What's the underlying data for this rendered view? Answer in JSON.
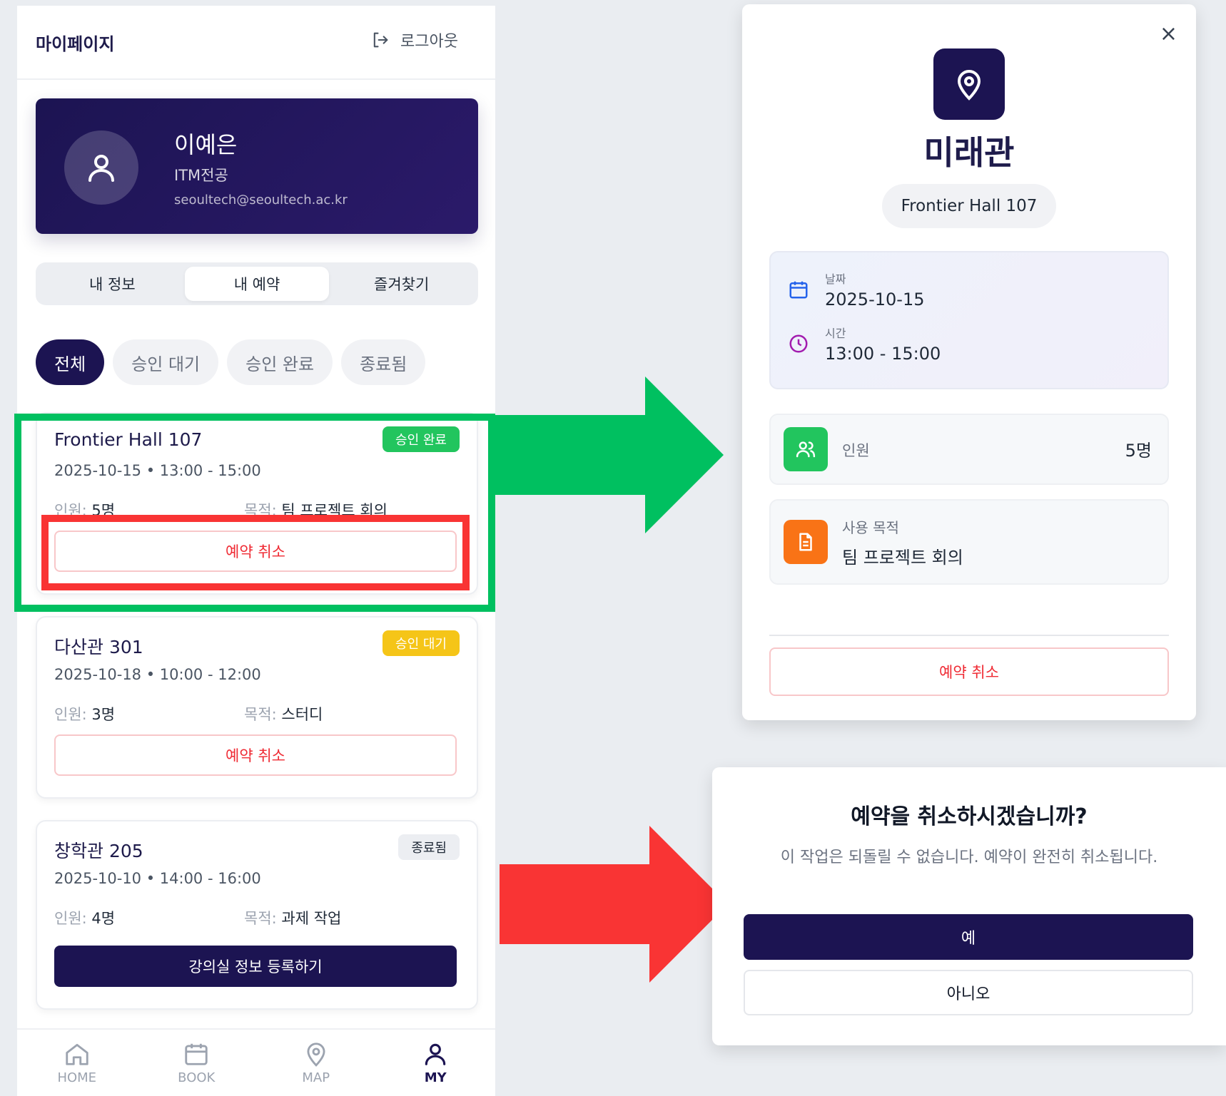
{
  "mypage": {
    "title": "마이페이지",
    "logout_label": "로그아웃",
    "profile": {
      "name": "이예은",
      "major": "ITM전공",
      "email": "seoultech@seoultech.ac.kr"
    },
    "tabs": [
      "내 정보",
      "내 예약",
      "즐겨찾기"
    ],
    "active_tab": "내 예약",
    "filters": [
      "전체",
      "승인 대기",
      "승인 완료",
      "종료됨"
    ],
    "active_filter": "전체",
    "people_label": "인원:",
    "purpose_label": "목적:",
    "reservations": [
      {
        "room": "Frontier Hall 107",
        "datetime": "2025-10-15 • 13:00 - 15:00",
        "status": "승인 완료",
        "people": "5명",
        "purpose": "팀 프로젝트 회의",
        "action": "예약 취소"
      },
      {
        "room": "다산관 301",
        "datetime": "2025-10-18 • 10:00 - 12:00",
        "status": "승인 대기",
        "people": "3명",
        "purpose": "스터디",
        "action": "예약 취소"
      },
      {
        "room": "창학관 205",
        "datetime": "2025-10-10 • 14:00 - 16:00",
        "status": "종료됨",
        "people": "4명",
        "purpose": "과제 작업",
        "action": "강의실 정보 등록하기"
      }
    ],
    "bottom_nav": [
      "HOME",
      "BOOK",
      "MAP",
      "MY"
    ],
    "active_nav": "MY"
  },
  "detail": {
    "close_glyph": "×",
    "building": "미래관",
    "room": "Frontier Hall 107",
    "date_label": "날짜",
    "date": "2025-10-15",
    "time_label": "시간",
    "time": "13:00 - 15:00",
    "people_label": "인원",
    "people": "5명",
    "purpose_label": "사용 목적",
    "purpose": "팀 프로젝트 회의",
    "cancel_label": "예약 취소"
  },
  "confirm": {
    "title": "예약을 취소하시겠습니까?",
    "subtitle": "이 작업은 되돌릴 수 없습니다. 예약이 완전히 취소됩니다.",
    "yes_label": "예",
    "no_label": "아니오"
  },
  "colors": {
    "brand": "#1c1452",
    "approved": "#22c55e",
    "pending": "#f5c518",
    "danger": "#ef2a33",
    "highlight_green": "#00c060",
    "highlight_red": "#f93434"
  }
}
